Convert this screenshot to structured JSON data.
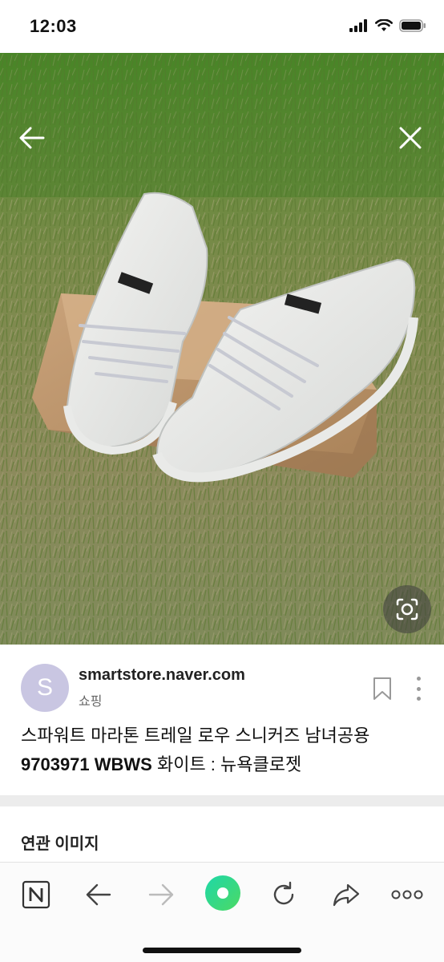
{
  "status_bar": {
    "time": "12:03"
  },
  "viewer": {
    "back_icon": "back-arrow-icon",
    "close_icon": "close-icon",
    "lens_icon": "lens-search-icon"
  },
  "source": {
    "avatar_letter": "S",
    "domain": "smartstore.naver.com",
    "category": "쇼핑"
  },
  "title": {
    "line1": "스파워트 마라톤 트레일 로우 스니커즈 남녀공용",
    "line2_bold": "9703971 WBWS",
    "line2_rest": " 화이트 : 뉴욕클로젯"
  },
  "related": {
    "heading": "연관 이미지"
  },
  "toolbar": {
    "items": [
      "naver-home-icon",
      "back-icon",
      "forward-icon",
      "green-dot-icon",
      "refresh-icon",
      "share-icon",
      "more-icon"
    ]
  },
  "colors": {
    "avatar_bg": "#c9c6e2",
    "green_button": "#2fd58a",
    "divider": "#ececec"
  }
}
